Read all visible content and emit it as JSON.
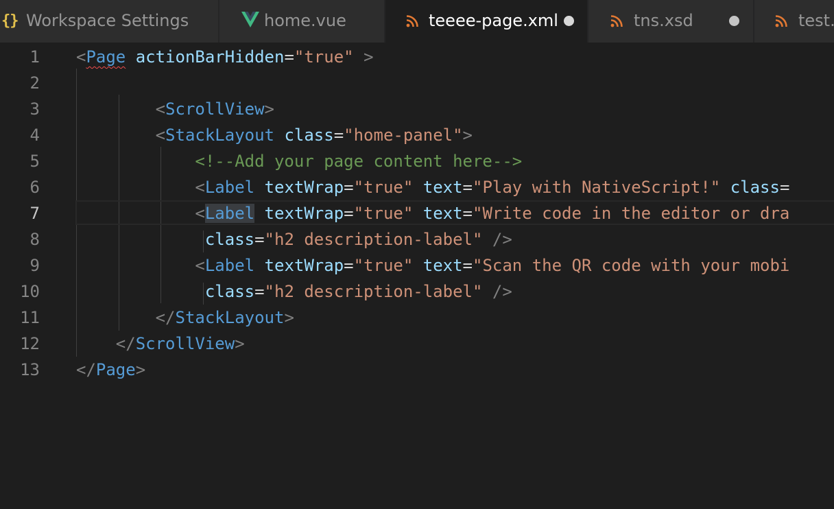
{
  "tabs": [
    {
      "label": "Workspace Settings",
      "icon": "braces-icon",
      "active": false,
      "dirty": false
    },
    {
      "label": "home.vue",
      "icon": "vue-icon",
      "active": false,
      "dirty": false
    },
    {
      "label": "teeee-page.xml",
      "icon": "rss-icon",
      "active": true,
      "dirty": true
    },
    {
      "label": "tns.xsd",
      "icon": "rss-icon",
      "active": false,
      "dirty": true
    },
    {
      "label": "test.x",
      "icon": "rss-icon",
      "active": false,
      "dirty": false
    }
  ],
  "icons": {
    "braces_glyph": "{}"
  },
  "colors": {
    "tag": "#569cd6",
    "attribute": "#9cdcfe",
    "string": "#ce9178",
    "comment": "#6a9955",
    "bracket": "#808080",
    "rss_orange": "#e37933",
    "vue_green": "#41b883",
    "braces_yellow": "#e2c04c"
  },
  "editor": {
    "current_line": 7,
    "lines": [
      {
        "num": "1",
        "tokens": [
          {
            "t": "<",
            "c": "br"
          },
          {
            "t": "Page",
            "c": "tag",
            "squiggle": true
          },
          {
            "t": " "
          },
          {
            "t": "actionBarHidden",
            "c": "attr"
          },
          {
            "t": "=",
            "c": "eq"
          },
          {
            "t": "\"true\"",
            "c": "str"
          },
          {
            "t": " "
          },
          {
            "t": ">",
            "c": "br"
          }
        ]
      },
      {
        "num": "2",
        "tokens": []
      },
      {
        "num": "3",
        "tokens": [
          {
            "t": "        "
          },
          {
            "t": "<",
            "c": "br"
          },
          {
            "t": "ScrollView",
            "c": "tag"
          },
          {
            "t": ">",
            "c": "br"
          }
        ]
      },
      {
        "num": "4",
        "tokens": [
          {
            "t": "        "
          },
          {
            "t": "<",
            "c": "br"
          },
          {
            "t": "StackLayout",
            "c": "tag"
          },
          {
            "t": " "
          },
          {
            "t": "class",
            "c": "attr"
          },
          {
            "t": "=",
            "c": "eq"
          },
          {
            "t": "\"home-panel\"",
            "c": "str"
          },
          {
            "t": ">",
            "c": "br"
          }
        ]
      },
      {
        "num": "5",
        "tokens": [
          {
            "t": "            "
          },
          {
            "t": "<!--Add your page content here-->",
            "c": "com"
          }
        ]
      },
      {
        "num": "6",
        "tokens": [
          {
            "t": "            "
          },
          {
            "t": "<",
            "c": "br"
          },
          {
            "t": "Label",
            "c": "tag"
          },
          {
            "t": " "
          },
          {
            "t": "textWrap",
            "c": "attr"
          },
          {
            "t": "=",
            "c": "eq"
          },
          {
            "t": "\"true\"",
            "c": "str"
          },
          {
            "t": " "
          },
          {
            "t": "text",
            "c": "attr"
          },
          {
            "t": "=",
            "c": "eq"
          },
          {
            "t": "\"Play with NativeScript!\"",
            "c": "str"
          },
          {
            "t": " "
          },
          {
            "t": "class",
            "c": "attr"
          },
          {
            "t": "=",
            "c": "eq"
          }
        ]
      },
      {
        "num": "7",
        "tokens": [
          {
            "t": "            "
          },
          {
            "t": "<",
            "c": "br"
          },
          {
            "t": "Label",
            "c": "tag",
            "highlight": true
          },
          {
            "t": " "
          },
          {
            "t": "textWrap",
            "c": "attr"
          },
          {
            "t": "=",
            "c": "eq"
          },
          {
            "t": "\"true\"",
            "c": "str"
          },
          {
            "t": " "
          },
          {
            "t": "text",
            "c": "attr"
          },
          {
            "t": "=",
            "c": "eq"
          },
          {
            "t": "\"Write code in the editor or dra",
            "c": "str"
          }
        ]
      },
      {
        "num": "8",
        "tokens": [
          {
            "t": "             "
          },
          {
            "t": "class",
            "c": "attr"
          },
          {
            "t": "=",
            "c": "eq"
          },
          {
            "t": "\"h2 description-label\"",
            "c": "str"
          },
          {
            "t": " "
          },
          {
            "t": "/>",
            "c": "br"
          }
        ]
      },
      {
        "num": "9",
        "tokens": [
          {
            "t": "            "
          },
          {
            "t": "<",
            "c": "br"
          },
          {
            "t": "Label",
            "c": "tag"
          },
          {
            "t": " "
          },
          {
            "t": "textWrap",
            "c": "attr"
          },
          {
            "t": "=",
            "c": "eq"
          },
          {
            "t": "\"true\"",
            "c": "str"
          },
          {
            "t": " "
          },
          {
            "t": "text",
            "c": "attr"
          },
          {
            "t": "=",
            "c": "eq"
          },
          {
            "t": "\"Scan the QR code with your mobi",
            "c": "str"
          }
        ]
      },
      {
        "num": "10",
        "tokens": [
          {
            "t": "             "
          },
          {
            "t": "class",
            "c": "attr"
          },
          {
            "t": "=",
            "c": "eq"
          },
          {
            "t": "\"h2 description-label\"",
            "c": "str"
          },
          {
            "t": " "
          },
          {
            "t": "/>",
            "c": "br"
          }
        ]
      },
      {
        "num": "11",
        "tokens": [
          {
            "t": "        "
          },
          {
            "t": "</",
            "c": "br"
          },
          {
            "t": "StackLayout",
            "c": "tag"
          },
          {
            "t": ">",
            "c": "br"
          }
        ]
      },
      {
        "num": "12",
        "tokens": [
          {
            "t": "    "
          },
          {
            "t": "</",
            "c": "br"
          },
          {
            "t": "ScrollView",
            "c": "tag"
          },
          {
            "t": ">",
            "c": "br"
          }
        ]
      },
      {
        "num": "13",
        "tokens": [
          {
            "t": "</",
            "c": "br"
          },
          {
            "t": "Page",
            "c": "tag"
          },
          {
            "t": ">",
            "c": "br"
          }
        ]
      }
    ]
  }
}
